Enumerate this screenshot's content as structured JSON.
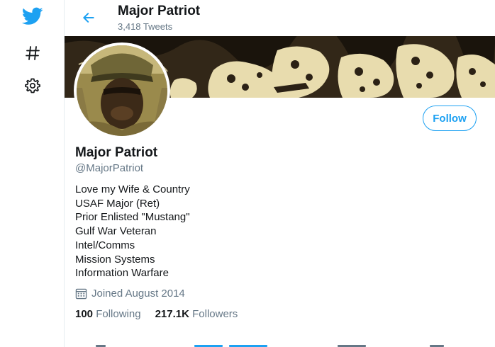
{
  "header": {
    "name": "Major Patriot",
    "tweet_count": "3,418 Tweets"
  },
  "profile": {
    "display_name": "Major Patriot",
    "handle": "@MajorPatriot",
    "bio_lines": [
      "Love my Wife & Country",
      "USAF Major (Ret)",
      "Prior Enlisted \"Mustang\"",
      "Gulf War Veteran",
      "Intel/Comms",
      "Mission Systems",
      "Information Warfare"
    ],
    "joined": "Joined August 2014",
    "following_count": "100",
    "following_label": "Following",
    "followers_count": "217.1K",
    "followers_label": "Followers"
  },
  "actions": {
    "follow_label": "Follow"
  },
  "colors": {
    "accent": "#1da1f2",
    "secondary_text": "#657786",
    "primary_text": "#14171a"
  },
  "icons": {
    "logo": "twitter-bird-icon",
    "explore": "hashtag-icon",
    "settings": "gear-icon",
    "back": "back-arrow-icon",
    "joined": "calendar-icon"
  }
}
